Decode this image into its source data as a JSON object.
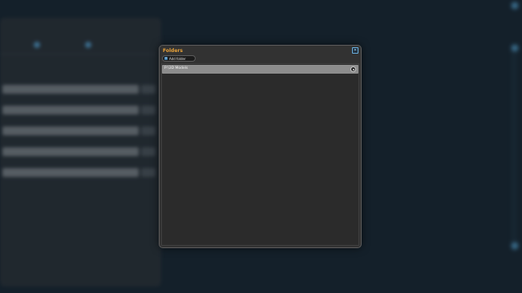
{
  "dialog": {
    "title": "Folders",
    "close_icon": "close-icon",
    "add_folder_label": "Add folder",
    "folders": [
      {
        "label": "P:\\3D Models",
        "action_icon": "remove-icon"
      }
    ]
  },
  "colors": {
    "accent_title": "#e8a23a",
    "backdrop": "#14202a",
    "dialog_bg": "#323232",
    "row_bg": "#8d8d8d",
    "highlight_blue": "#4f98c4"
  }
}
